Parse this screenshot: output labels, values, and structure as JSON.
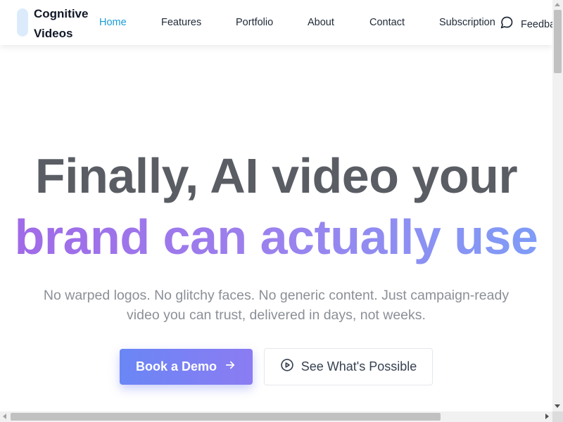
{
  "brand": {
    "line1": "Cognitive",
    "line2": "Videos"
  },
  "nav": {
    "items": [
      {
        "label": "Home",
        "active": true
      },
      {
        "label": "Features",
        "active": false
      },
      {
        "label": "Portfolio",
        "active": false
      },
      {
        "label": "About",
        "active": false
      },
      {
        "label": "Contact",
        "active": false
      },
      {
        "label": "Subscription",
        "active": false
      }
    ],
    "feedback_label": "Feedba",
    "feedback_icon": "message-circle-icon"
  },
  "hero": {
    "headline_line1": "Finally, AI video your",
    "headline_line2": "brand can actually use",
    "subtitle": "No warped logos. No glitchy faces. No generic content. Just campaign-ready video you can trust, delivered in days, not weeks.",
    "primary_cta": "Book a Demo",
    "primary_cta_icon": "arrow-right-icon",
    "secondary_cta": "See What's Possible",
    "secondary_cta_icon": "play-circle-icon"
  },
  "colors": {
    "active_nav": "#1a9bd7",
    "headline": "#5a5d63",
    "gradient_start": "#a06ae8",
    "gradient_end": "#7f9cf6",
    "button_start": "#6a86f5",
    "button_end": "#8b7cf2"
  }
}
